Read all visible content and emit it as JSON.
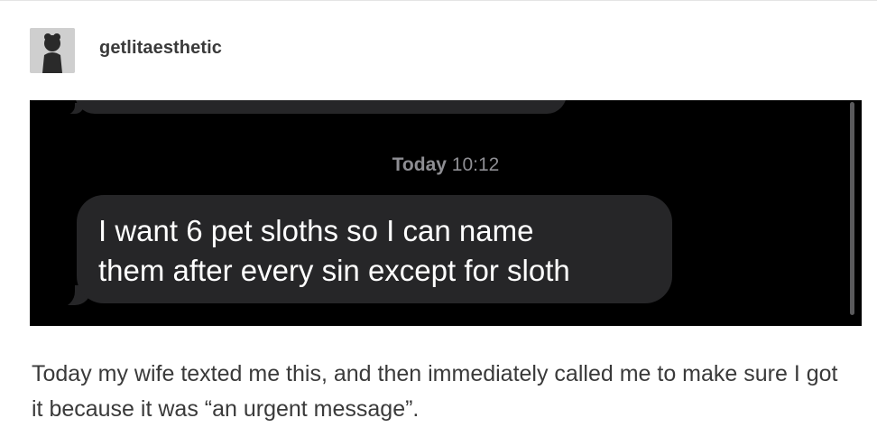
{
  "post": {
    "username": "getlitaesthetic",
    "caption": "Today my wife texted me this, and then immediately called me to make sure I got it because it was “an urgent message”."
  },
  "screenshot": {
    "timestamp_day": "Today",
    "timestamp_time": "10:12",
    "message_line1": "I want 6 pet sloths so I can name",
    "message_line2": "them after every sin except for sloth"
  },
  "icons": {
    "avatar": "user-avatar-icon"
  }
}
